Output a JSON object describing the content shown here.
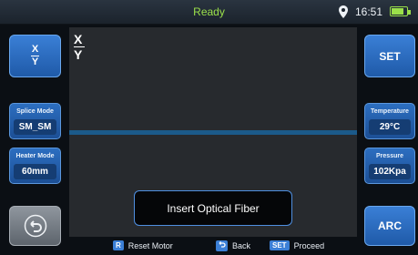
{
  "status": {
    "state": "Ready",
    "time": "16:51",
    "battery_level": 0.8
  },
  "buttons": {
    "view_numerator": "X",
    "view_denominator": "Y",
    "set": "SET",
    "arc": "ARC"
  },
  "screen": {
    "numerator": "X",
    "denominator": "Y"
  },
  "panels": {
    "splice_mode": {
      "title": "Splice Mode",
      "value": "SM_SM"
    },
    "heater_mode": {
      "title": "Heater Mode",
      "value": "60mm"
    },
    "temperature": {
      "title": "Temperature",
      "value": "29°C"
    },
    "pressure": {
      "title": "Pressure",
      "value": "102Kpa"
    }
  },
  "prompt": "Insert Optical Fiber",
  "hints": [
    {
      "key": "R",
      "label": "Reset Motor"
    },
    {
      "key": "back-icon",
      "label": "Back"
    },
    {
      "key": "SET",
      "label": "Proceed"
    }
  ],
  "colors": {
    "accent_blue": "#3a7fd6",
    "status_green": "#9be04a",
    "screen_bg": "#272a2e"
  }
}
